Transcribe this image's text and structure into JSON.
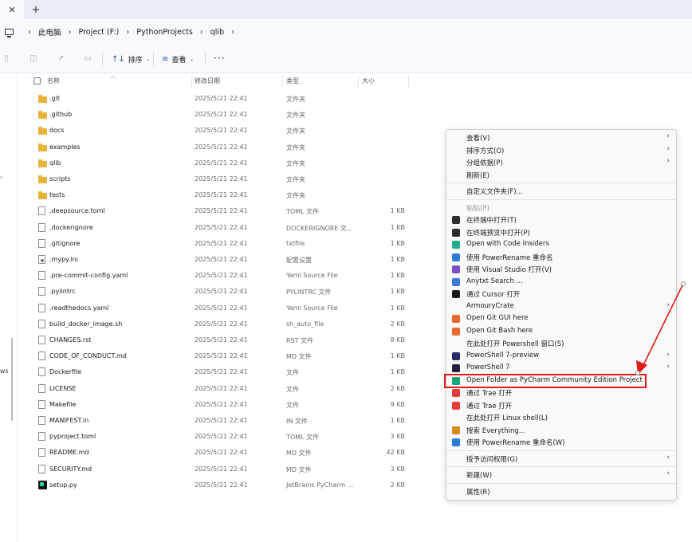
{
  "tabs": {
    "close_glyph": "✕",
    "new_tab_glyph": "+"
  },
  "address": {
    "crumbs": [
      "此电脑",
      "Project (F:)",
      "PythonProjects",
      "qlib"
    ],
    "separator": "›"
  },
  "toolbar": {
    "sort_label": "排序",
    "view_label": "查看",
    "more_label": "···",
    "sort_icon": "↑↓",
    "view_icon": "≡",
    "caret": "⌄"
  },
  "nav": {
    "fragment": "ws",
    "mark": "›"
  },
  "list": {
    "columns": {
      "name": "名称",
      "modified": "修改日期",
      "type": "类型",
      "size": "大小"
    },
    "files": [
      {
        "name": ".git",
        "date": "2025/5/21 22:41",
        "type": "文件夹",
        "size": "",
        "icon": "folder-icon"
      },
      {
        "name": ".github",
        "date": "2025/5/21 22:41",
        "type": "文件夹",
        "size": "",
        "icon": "folder-icon"
      },
      {
        "name": "docs",
        "date": "2025/5/21 22:41",
        "type": "文件夹",
        "size": "",
        "icon": "folder-icon"
      },
      {
        "name": "examples",
        "date": "2025/5/21 22:41",
        "type": "文件夹",
        "size": "",
        "icon": "folder-icon"
      },
      {
        "name": "qlib",
        "date": "2025/5/21 22:41",
        "type": "文件夹",
        "size": "",
        "icon": "folder-icon"
      },
      {
        "name": "scripts",
        "date": "2025/5/21 22:41",
        "type": "文件夹",
        "size": "",
        "icon": "folder-icon"
      },
      {
        "name": "tests",
        "date": "2025/5/21 22:41",
        "type": "文件夹",
        "size": "",
        "icon": "folder-icon"
      },
      {
        "name": ".deepsource.toml",
        "date": "2025/5/21 22:41",
        "type": "TOML 文件",
        "size": "1 KB",
        "icon": "file-icon"
      },
      {
        "name": ".dockerignore",
        "date": "2025/5/21 22:41",
        "type": "DOCKERIGNORE 文...",
        "size": "1 KB",
        "icon": "file-icon"
      },
      {
        "name": ".gitignore",
        "date": "2025/5/21 22:41",
        "type": "txtfile",
        "size": "1 KB",
        "icon": "file-icon"
      },
      {
        "name": ".mypy.ini",
        "date": "2025/5/21 22:41",
        "type": "配置设置",
        "size": "1 KB",
        "icon": "settings-file-icon"
      },
      {
        "name": ".pre-commit-config.yaml",
        "date": "2025/5/21 22:41",
        "type": "Yaml Source File",
        "size": "1 KB",
        "icon": "file-icon"
      },
      {
        "name": ".pylintrc",
        "date": "2025/5/21 22:41",
        "type": "PYLINTRC 文件",
        "size": "1 KB",
        "icon": "file-icon"
      },
      {
        "name": ".readthedocs.yaml",
        "date": "2025/5/21 22:41",
        "type": "Yaml Source File",
        "size": "1 KB",
        "icon": "file-icon"
      },
      {
        "name": "build_docker_image.sh",
        "date": "2025/5/21 22:41",
        "type": "sh_auto_file",
        "size": "2 KB",
        "icon": "file-icon"
      },
      {
        "name": "CHANGES.rst",
        "date": "2025/5/21 22:41",
        "type": "RST 文件",
        "size": "8 KB",
        "icon": "file-icon"
      },
      {
        "name": "CODE_OF_CONDUCT.md",
        "date": "2025/5/21 22:41",
        "type": "MD 文件",
        "size": "1 KB",
        "icon": "file-icon"
      },
      {
        "name": "Dockerfile",
        "date": "2025/5/21 22:41",
        "type": "文件",
        "size": "1 KB",
        "icon": "file-icon"
      },
      {
        "name": "LICENSE",
        "date": "2025/5/21 22:41",
        "type": "文件",
        "size": "2 KB",
        "icon": "file-icon"
      },
      {
        "name": "Makefile",
        "date": "2025/5/21 22:41",
        "type": "文件",
        "size": "9 KB",
        "icon": "file-icon"
      },
      {
        "name": "MANIFEST.in",
        "date": "2025/5/21 22:41",
        "type": "IN 文件",
        "size": "1 KB",
        "icon": "file-icon"
      },
      {
        "name": "pyproject.toml",
        "date": "2025/5/21 22:41",
        "type": "TOML 文件",
        "size": "3 KB",
        "icon": "file-icon"
      },
      {
        "name": "README.md",
        "date": "2025/5/21 22:41",
        "type": "MD 文件",
        "size": "42 KB",
        "icon": "file-icon"
      },
      {
        "name": "SECURITY.md",
        "date": "2025/5/21 22:41",
        "type": "MD 文件",
        "size": "3 KB",
        "icon": "file-icon"
      },
      {
        "name": "setup.py",
        "date": "2025/5/21 22:41",
        "type": "JetBrains PyCharm ...",
        "size": "2 KB",
        "icon": "pycharm-file-icon"
      }
    ]
  },
  "context_menu": {
    "items": [
      {
        "label": "查看(V)",
        "arrow": "›",
        "icon": "",
        "color": "",
        "disabled": false
      },
      {
        "label": "排序方式(O)",
        "arrow": "›",
        "icon": "",
        "color": "",
        "disabled": false
      },
      {
        "label": "分组依据(P)",
        "arrow": "›",
        "icon": "",
        "color": "",
        "disabled": false
      },
      {
        "label": "刷新(E)",
        "arrow": "",
        "icon": "",
        "color": "",
        "disabled": false
      },
      {
        "sep": true
      },
      {
        "label": "自定义文件夹(F)...",
        "arrow": "",
        "icon": "",
        "color": "",
        "disabled": false
      },
      {
        "sep": true
      },
      {
        "label": "粘贴(P)",
        "arrow": "",
        "icon": "",
        "color": "",
        "disabled": true
      },
      {
        "label": "在终端中打开(T)",
        "arrow": "",
        "icon": "terminal-icon",
        "color": "#2b2b2b",
        "disabled": false
      },
      {
        "label": "在终端预览中打开(P)",
        "arrow": "",
        "icon": "terminal-preview-icon",
        "color": "#2b2b2b",
        "disabled": false
      },
      {
        "label": "Open with Code Insiders",
        "arrow": "",
        "icon": "vscode-insiders-icon",
        "color": "#1fb08c",
        "disabled": false
      },
      {
        "label": "使用 PowerRename 重命名",
        "arrow": "",
        "icon": "powerrename-icon",
        "color": "#2f7bd8",
        "disabled": false
      },
      {
        "label": "使用 Visual Studio 打开(V)",
        "arrow": "",
        "icon": "visual-studio-icon",
        "color": "#7b4fc9",
        "disabled": false
      },
      {
        "label": "Anytxt Search ...",
        "arrow": "",
        "icon": "anytxt-icon",
        "color": "#3a7bd5",
        "disabled": false
      },
      {
        "label": "通过 Cursor 打开",
        "arrow": "",
        "icon": "cursor-icon",
        "color": "#1a1a1a",
        "disabled": false
      },
      {
        "label": "ArmouryCrate",
        "arrow": "›",
        "icon": "",
        "color": "",
        "disabled": false
      },
      {
        "label": "Open Git GUI here",
        "arrow": "",
        "icon": "git-gui-icon",
        "color": "#e8692d",
        "disabled": false
      },
      {
        "label": "Open Git Bash here",
        "arrow": "",
        "icon": "git-bash-icon",
        "color": "#e8692d",
        "disabled": false
      },
      {
        "label": "在此处打开 Powershell 窗口(S)",
        "arrow": "",
        "icon": "",
        "color": "",
        "disabled": false
      },
      {
        "label": "PowerShell 7-preview",
        "arrow": "›",
        "icon": "powershell-preview-icon",
        "color": "#2b2b6b",
        "disabled": false
      },
      {
        "label": "PowerShell 7",
        "arrow": "›",
        "icon": "powershell-icon",
        "color": "#1f1f3a",
        "disabled": false
      },
      {
        "label": "Open Folder as PyCharm Community Edition Project",
        "arrow": "",
        "icon": "pycharm-icon",
        "color": "#18a57a",
        "disabled": false
      },
      {
        "label": "通过 Trae 打开",
        "arrow": "",
        "icon": "trae-icon",
        "color": "#e53b3b",
        "disabled": false
      },
      {
        "label": "通过 Trae 打开",
        "arrow": "",
        "icon": "trae-icon",
        "color": "#e53b3b",
        "disabled": false
      },
      {
        "label": "在此处打开 Linux shell(L)",
        "arrow": "",
        "icon": "",
        "color": "",
        "disabled": false
      },
      {
        "label": "搜索 Everything...",
        "arrow": "",
        "icon": "everything-search-icon",
        "color": "#d98a1a",
        "disabled": false
      },
      {
        "label": "使用 PowerRename 重命名(W)",
        "arrow": "",
        "icon": "powerrename-icon",
        "color": "#2f7bd8",
        "disabled": false
      },
      {
        "sep": true
      },
      {
        "label": "授予访问权限(G)",
        "arrow": "›",
        "icon": "",
        "color": "",
        "disabled": false
      },
      {
        "sep": true
      },
      {
        "label": "新建(W)",
        "arrow": "›",
        "icon": "",
        "color": "",
        "disabled": false
      },
      {
        "sep": true
      },
      {
        "label": "属性(R)",
        "arrow": "",
        "icon": "",
        "color": "",
        "disabled": false
      }
    ]
  },
  "annotation": {
    "highlight_color": "#e31a1a"
  }
}
